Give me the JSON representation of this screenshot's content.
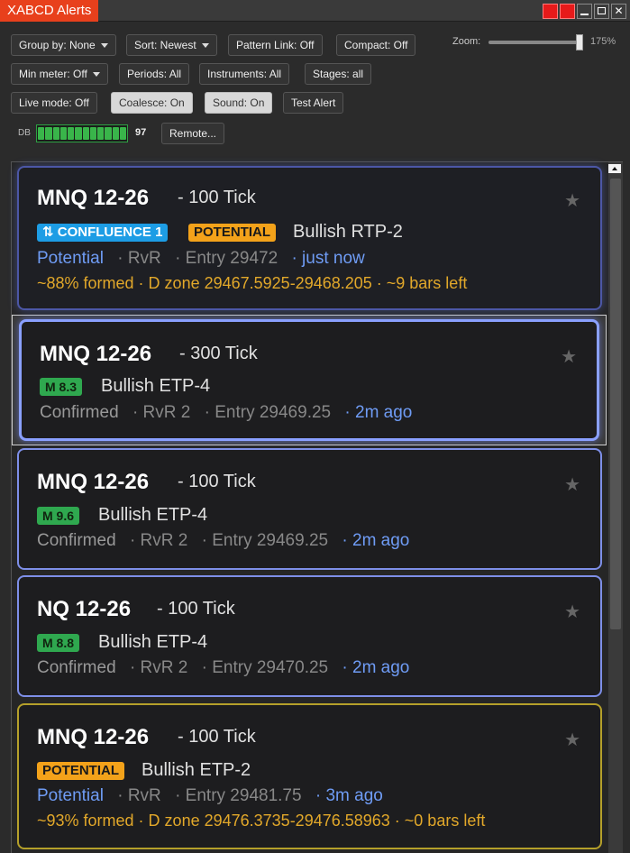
{
  "window": {
    "title": "XABCD Alerts"
  },
  "toolbar": {
    "group_by": "Group by: None",
    "sort": "Sort: Newest",
    "pattern_link": "Pattern Link: Off",
    "compact": "Compact: Off",
    "min_meter": "Min meter: Off",
    "periods": "Periods: All",
    "instruments": "Instruments: All",
    "stages": "Stages: all",
    "live_mode": "Live mode: Off",
    "coalesce": "Coalesce: On",
    "sound": "Sound: On",
    "test_alert": "Test Alert",
    "remote": "Remote...",
    "zoom_label": "Zoom:",
    "zoom_value": "175%",
    "zoom_level": 1.75,
    "db_label": "DB",
    "db_value": "97"
  },
  "icons": {
    "star": "star-icon",
    "confluence": "swap-arrows-icon"
  },
  "colors": {
    "title_accent": "#e8401c",
    "potential": "#f3a21a",
    "confluence": "#1d9de5",
    "meter": "#2fa84f",
    "link_blue": "#6f9cf5",
    "formed": "#e2a82a"
  },
  "alerts": [
    {
      "symbol": "MNQ 12-26",
      "period": "- 100 Tick",
      "confluence_badge": "⇅ CONFLUENCE 1",
      "stage_badge": "POTENTIAL",
      "pattern": "Bullish RTP-2",
      "status": "Potential",
      "rvr": "· RvR",
      "entry": "· Entry 29472",
      "time": "· just now",
      "formed": "~88% formed · D zone 29467.5925-29468.205 · ~9 bars left"
    },
    {
      "symbol": "MNQ 12-26",
      "period": "- 300 Tick",
      "meter": "M 8.3",
      "pattern": "Bullish ETP-4",
      "status": "Confirmed",
      "rvr": "· RvR 2",
      "entry": "· Entry 29469.25",
      "time": "· 2m ago"
    },
    {
      "symbol": "MNQ 12-26",
      "period": "- 100 Tick",
      "meter": "M 9.6",
      "pattern": "Bullish ETP-4",
      "status": "Confirmed",
      "rvr": "· RvR 2",
      "entry": "· Entry 29469.25",
      "time": "· 2m ago"
    },
    {
      "symbol": "NQ 12-26",
      "period": "- 100 Tick",
      "meter": "M 8.8",
      "pattern": "Bullish ETP-4",
      "status": "Confirmed",
      "rvr": "· RvR 2",
      "entry": "· Entry 29470.25",
      "time": "· 2m ago"
    },
    {
      "symbol": "MNQ 12-26",
      "period": "- 100 Tick",
      "stage_badge": "POTENTIAL",
      "pattern": "Bullish ETP-2",
      "status": "Potential",
      "rvr": "· RvR",
      "entry": "· Entry 29481.75",
      "time": "· 3m ago",
      "formed": "~93% formed · D zone 29476.3735-29476.58963 · ~0 bars left"
    }
  ]
}
